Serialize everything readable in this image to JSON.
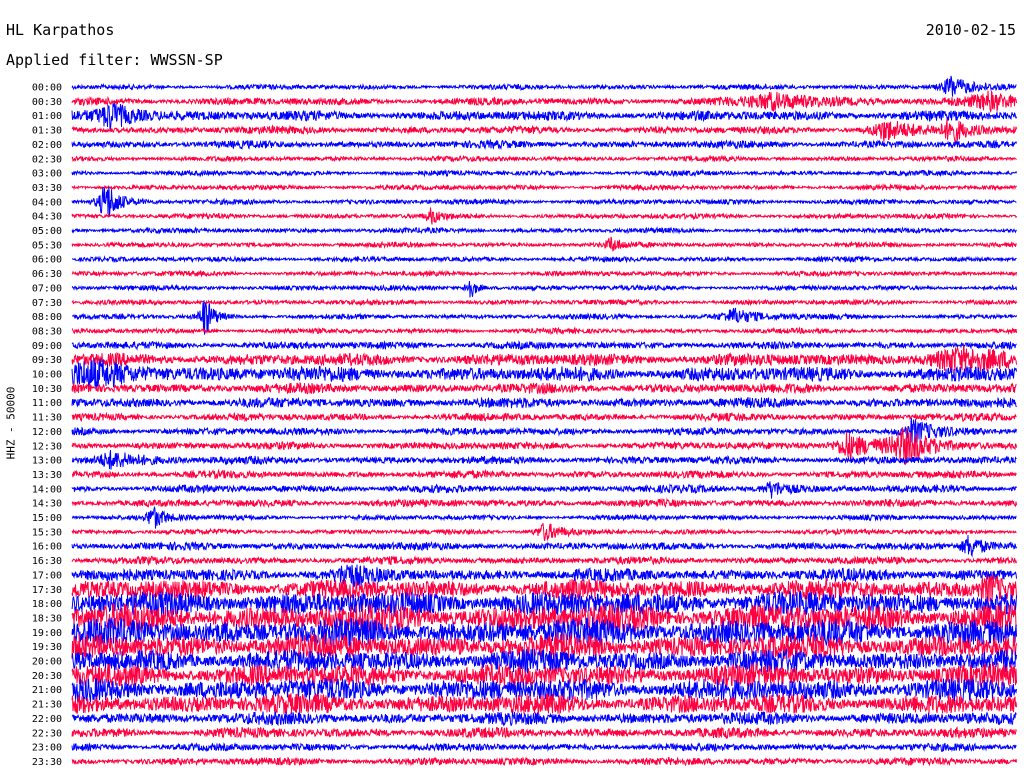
{
  "header": {
    "station": "HL Karpathos",
    "date": "2010-02-15",
    "filter": "Applied filter: WWSSN-SP"
  },
  "chart_data": {
    "type": "line",
    "title": "HL Karpathos",
    "ylabel": "HHZ - 50000",
    "xlabel": "",
    "row_labels": [
      "00:00",
      "00:30",
      "01:00",
      "01:30",
      "02:00",
      "02:30",
      "03:00",
      "03:30",
      "04:00",
      "04:30",
      "05:00",
      "05:30",
      "06:00",
      "06:30",
      "07:00",
      "07:30",
      "08:00",
      "08:30",
      "09:00",
      "09:30",
      "10:00",
      "10:30",
      "11:00",
      "11:30",
      "12:00",
      "12:30",
      "13:00",
      "13:30",
      "14:00",
      "14:30",
      "15:00",
      "15:30",
      "16:00",
      "16:30",
      "17:00",
      "17:30",
      "18:00",
      "18:30",
      "19:00",
      "19:30",
      "20:00",
      "20:30",
      "21:00",
      "21:30",
      "22:00",
      "22:30",
      "23:00",
      "23:30"
    ],
    "colors": [
      "#0000ff",
      "#ff0040"
    ],
    "noise_level": [
      2,
      3,
      4,
      3,
      3,
      2,
      2,
      2,
      2,
      2,
      2,
      2,
      2,
      2,
      2,
      2,
      2,
      2,
      3,
      5,
      6,
      4,
      4,
      3,
      3,
      3,
      3,
      3,
      3,
      3,
      2,
      2,
      3,
      3,
      5,
      8,
      10,
      11,
      11,
      10,
      9,
      9,
      9,
      8,
      5,
      4,
      3,
      3
    ],
    "events": [
      {
        "row": 0,
        "x": 0.93,
        "amp": 12,
        "width": 0.02
      },
      {
        "row": 1,
        "x": 0.74,
        "amp": 8,
        "width": 0.06
      },
      {
        "row": 1,
        "x": 0.97,
        "amp": 8,
        "width": 0.04
      },
      {
        "row": 2,
        "x": 0.04,
        "amp": 14,
        "width": 0.03
      },
      {
        "row": 3,
        "x": 0.86,
        "amp": 10,
        "width": 0.03
      },
      {
        "row": 3,
        "x": 0.93,
        "amp": 12,
        "width": 0.02
      },
      {
        "row": 8,
        "x": 0.035,
        "amp": 22,
        "width": 0.015
      },
      {
        "row": 9,
        "x": 0.38,
        "amp": 8,
        "width": 0.01
      },
      {
        "row": 11,
        "x": 0.57,
        "amp": 8,
        "width": 0.01
      },
      {
        "row": 14,
        "x": 0.42,
        "amp": 14,
        "width": 0.008
      },
      {
        "row": 16,
        "x": 0.14,
        "amp": 22,
        "width": 0.01
      },
      {
        "row": 16,
        "x": 0.7,
        "amp": 8,
        "width": 0.03
      },
      {
        "row": 19,
        "x": 0.93,
        "amp": 10,
        "width": 0.06
      },
      {
        "row": 20,
        "x": 0.02,
        "amp": 10,
        "width": 0.06
      },
      {
        "row": 24,
        "x": 0.89,
        "amp": 12,
        "width": 0.02
      },
      {
        "row": 25,
        "x": 0.82,
        "amp": 14,
        "width": 0.03
      },
      {
        "row": 25,
        "x": 0.88,
        "amp": 16,
        "width": 0.03
      },
      {
        "row": 26,
        "x": 0.04,
        "amp": 8,
        "width": 0.04
      },
      {
        "row": 28,
        "x": 0.74,
        "amp": 8,
        "width": 0.02
      },
      {
        "row": 30,
        "x": 0.085,
        "amp": 12,
        "width": 0.015
      },
      {
        "row": 31,
        "x": 0.5,
        "amp": 10,
        "width": 0.02
      },
      {
        "row": 32,
        "x": 0.95,
        "amp": 12,
        "width": 0.02
      },
      {
        "row": 34,
        "x": 0.29,
        "amp": 10,
        "width": 0.02
      },
      {
        "row": 35,
        "x": 0.97,
        "amp": 14,
        "width": 0.02
      }
    ]
  }
}
